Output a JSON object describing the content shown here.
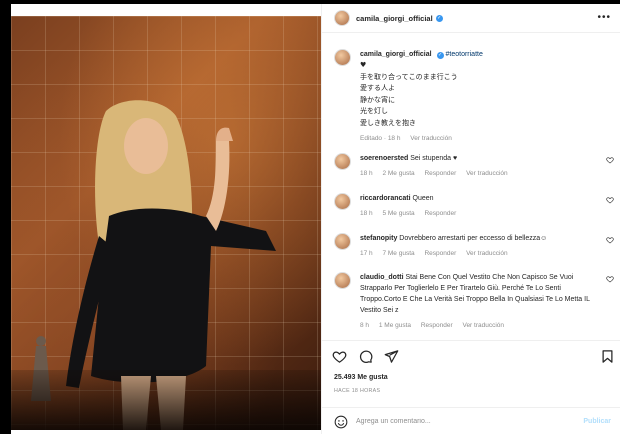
{
  "post": {
    "username": "camila_giorgi_official",
    "verified_badge": "✓",
    "more_icon": "•••"
  },
  "caption": {
    "username": "camila_giorgi_official",
    "hashtag": "#teotorriatte",
    "lines": [
      "♥",
      "手を取り合ってこのまま行こう",
      "愛する人よ",
      "静かな宵に",
      "光を灯し",
      "愛しき教えを抱き"
    ],
    "time": "Editado · 18 h",
    "translate": "Ver traducción"
  },
  "comments": [
    {
      "username": "soerenoersted",
      "text": "Sei stupenda ♥",
      "time": "18 h",
      "likes": "2 Me gusta",
      "reply": "Responder",
      "translate": "Ver traducción"
    },
    {
      "username": "riccardorancati",
      "text": "Queen",
      "time": "18 h",
      "likes": "5 Me gusta",
      "reply": "Responder"
    },
    {
      "username": "stefanopity",
      "text": "Dovrebbero arrestarti per eccesso di bellezza☺",
      "time": "17 h",
      "likes": "7 Me gusta",
      "reply": "Responder",
      "translate": "Ver traducción"
    },
    {
      "username": "claudio_dotti",
      "text": "Stai Bene Con Quel Vestito Che Non Capisco Se Vuoi Strapparlo Per Toglierlelo E Per Tirartelo Giù. Perché Te Lo Senti Troppo.Corto E Che La Verità Sei Troppo Bella In Qualsiasi Te Lo Metta IL Vestito Sei z",
      "time": "8 h",
      "likes": "1 Me gusta",
      "reply": "Responder",
      "translate": "Ver traducción"
    }
  ],
  "footer": {
    "likes": "25.493 Me gusta",
    "ago": "HACE 18 HORAS",
    "comment_placeholder": "Agrega un comentario...",
    "publish": "Publicar"
  },
  "colors": {
    "link": "#00376b",
    "verified": "#3897f0",
    "publish_disabled": "#b2dffc",
    "meta": "#8e8e8e"
  },
  "icons": [
    "heart-icon",
    "comment-icon",
    "share-icon",
    "bookmark-icon",
    "emoji-icon",
    "more-icon",
    "verified-icon"
  ]
}
